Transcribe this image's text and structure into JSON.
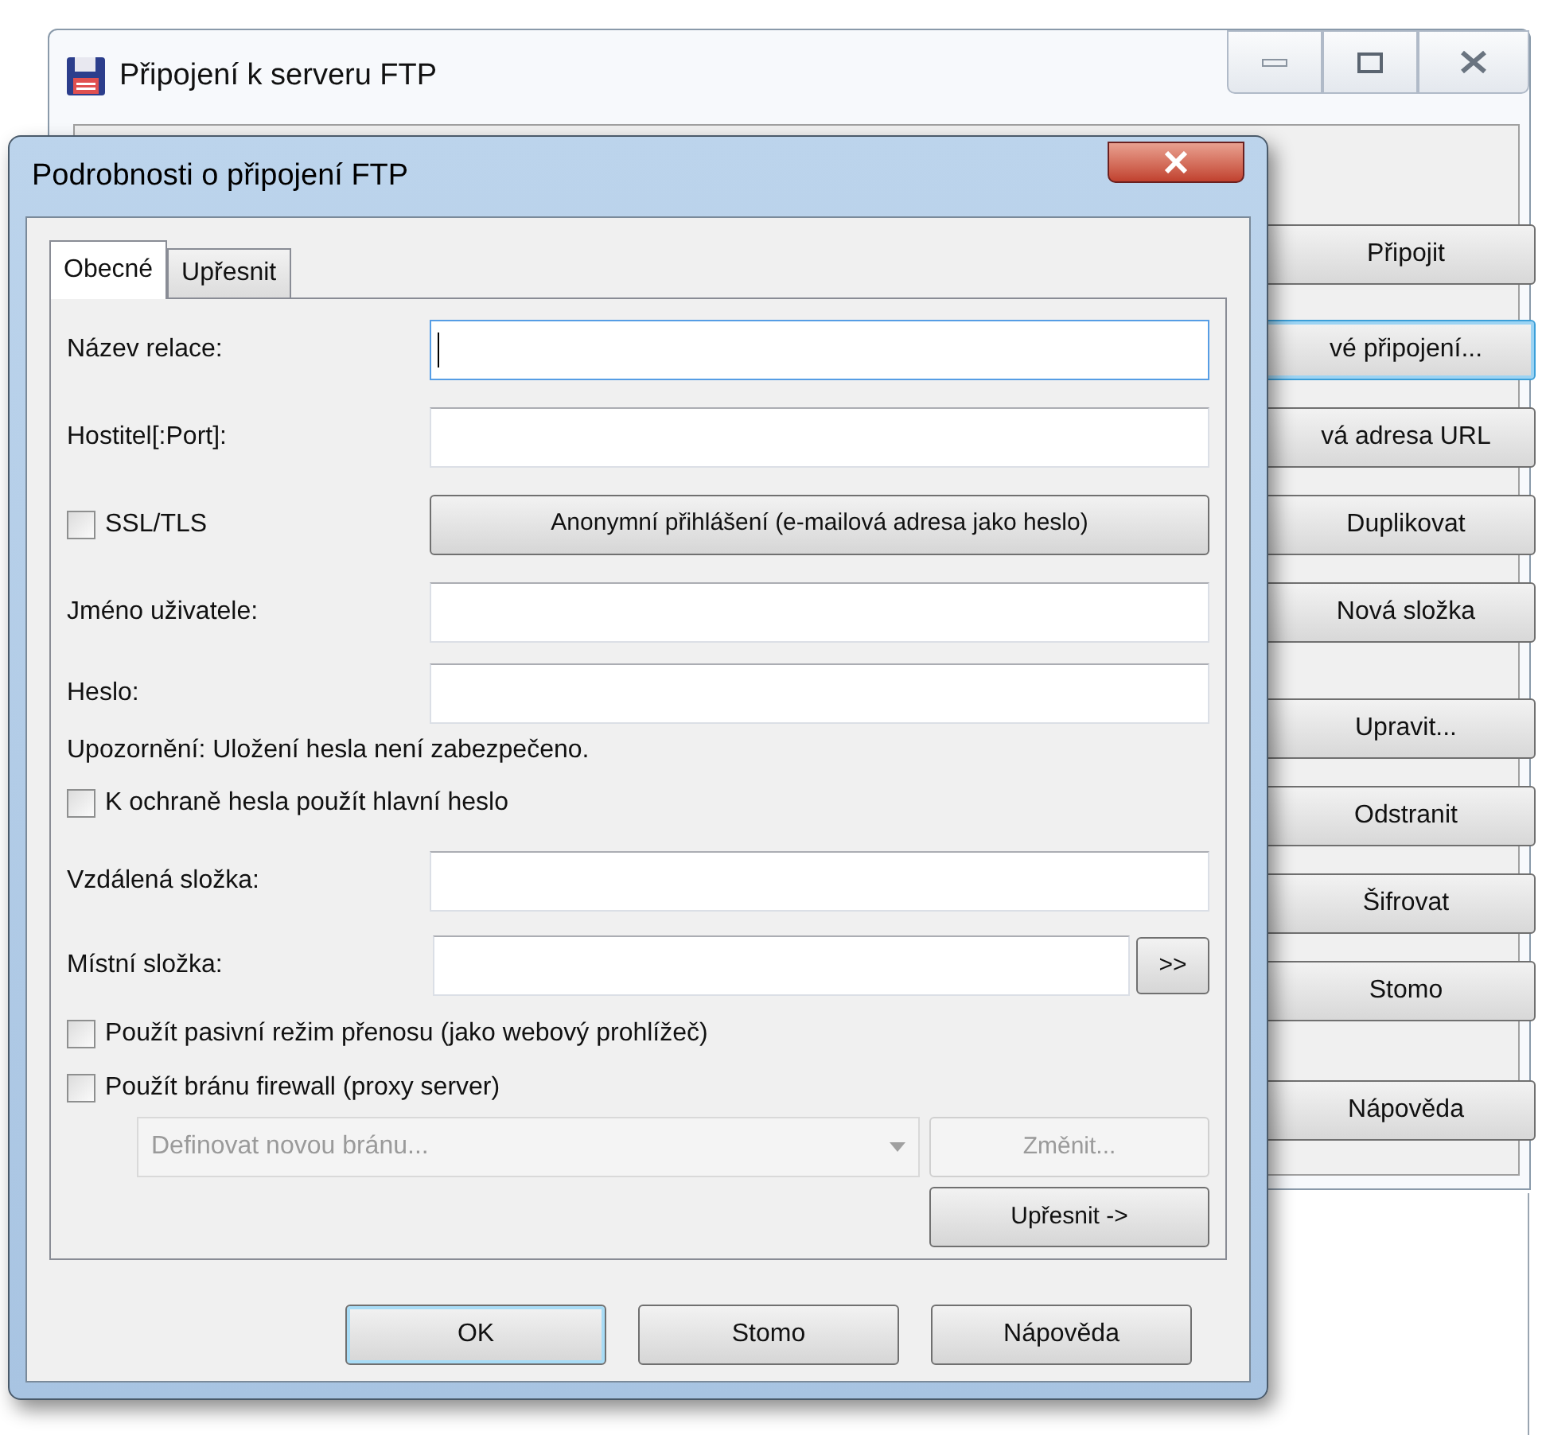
{
  "back_window": {
    "title": "Připojení k serveru FTP",
    "buttons": [
      {
        "label": "Připojit",
        "focused": false
      },
      {
        "label": "vé připojení...",
        "focused": true
      },
      {
        "label": "vá adresa URL",
        "focused": false
      },
      {
        "label": "Duplikovat",
        "focused": false
      },
      {
        "label": "Nová složka",
        "focused": false
      },
      {
        "label": "Upravit...",
        "focused": false
      },
      {
        "label": "Odstranit",
        "focused": false
      },
      {
        "label": "Šifrovat",
        "focused": false
      },
      {
        "label": "Stomo",
        "focused": false
      },
      {
        "label": "Nápověda",
        "focused": false
      }
    ]
  },
  "dialog": {
    "title": "Podrobnosti o připojení FTP",
    "tabs": [
      {
        "label": "Obecné",
        "selected": true
      },
      {
        "label": "Upřesnit",
        "selected": false
      }
    ],
    "rows": [
      {
        "kind": "field",
        "label": "Název relace:",
        "focused": true
      },
      {
        "kind": "field",
        "label": "Hostitel[:Port]:",
        "focused": false
      },
      {
        "kind": "checkbox_button",
        "label": "SSL/TLS",
        "checked": false,
        "button": "Anonymní přihlášení (e-mailová adresa jako heslo)"
      },
      {
        "kind": "field",
        "label": "Jméno uživatele:",
        "focused": false
      },
      {
        "kind": "field",
        "label": "Heslo:",
        "focused": false
      },
      {
        "kind": "note",
        "text": "Upozornění: Uložení hesla není zabezpečeno."
      },
      {
        "kind": "checkbox",
        "label": "K ochraně hesla použít hlavní heslo",
        "checked": false
      },
      {
        "kind": "field",
        "label": "Vzdálená složka:",
        "focused": false
      },
      {
        "kind": "browse",
        "label": "Místní složka:",
        "button": ">>"
      },
      {
        "kind": "checkbox",
        "label": "Použít pasivní režim přenosu (jako webový prohlížeč)",
        "checked": false
      },
      {
        "kind": "checkbox",
        "label": "Použít bránu firewall (proxy server)",
        "checked": false
      },
      {
        "kind": "combo",
        "value": "Definovat novou bránu...",
        "disabled": true,
        "button": "Změnit..."
      },
      {
        "kind": "right_button",
        "button": "Upřesnit ->"
      }
    ],
    "footer_buttons": [
      {
        "label": "OK",
        "default": true
      },
      {
        "label": "Stomo",
        "default": false
      },
      {
        "label": "Nápověda",
        "default": false
      }
    ]
  }
}
